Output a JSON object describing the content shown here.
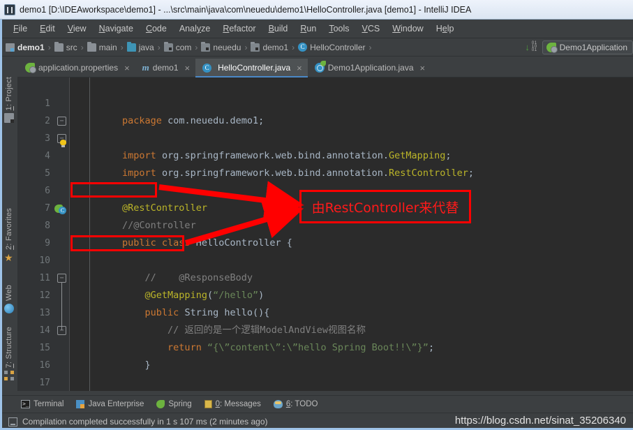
{
  "window": {
    "title": "demo1 [D:\\IDEAworkspace\\demo1] - ...\\src\\main\\java\\com\\neuedu\\demo1\\HelloController.java [demo1] - IntelliJ IDEA",
    "app_icon": "intellij-idea-icon"
  },
  "menubar": {
    "items": [
      {
        "label": "File",
        "mnemonic": "F"
      },
      {
        "label": "Edit",
        "mnemonic": "E"
      },
      {
        "label": "View",
        "mnemonic": "V"
      },
      {
        "label": "Navigate",
        "mnemonic": "N"
      },
      {
        "label": "Code",
        "mnemonic": "C"
      },
      {
        "label": "Analyze",
        "mnemonic": "y"
      },
      {
        "label": "Refactor",
        "mnemonic": "R"
      },
      {
        "label": "Build",
        "mnemonic": "B"
      },
      {
        "label": "Run",
        "mnemonic": "R"
      },
      {
        "label": "Tools",
        "mnemonic": "T"
      },
      {
        "label": "VCS",
        "mnemonic": "V"
      },
      {
        "label": "Window",
        "mnemonic": "W"
      },
      {
        "label": "Help",
        "mnemonic": "H"
      }
    ]
  },
  "breadcrumb": {
    "items": [
      {
        "label": "demo1",
        "icon": "module-icon"
      },
      {
        "label": "src",
        "icon": "folder-icon"
      },
      {
        "label": "main",
        "icon": "folder-icon"
      },
      {
        "label": "java",
        "icon": "source-folder-icon"
      },
      {
        "label": "com",
        "icon": "package-icon"
      },
      {
        "label": "neuedu",
        "icon": "package-icon"
      },
      {
        "label": "demo1",
        "icon": "package-icon"
      },
      {
        "label": "HelloController",
        "icon": "class-icon"
      }
    ],
    "separator": "›"
  },
  "toolbar_right": {
    "download_icon": "download-icon",
    "binary_icon": "binary-icon",
    "run_configuration": "Demo1Application",
    "run_config_icon": "spring-boot-icon"
  },
  "left_toolbar": {
    "items": [
      {
        "label": "1: Project",
        "mnemonic": "1",
        "icon": "project-icon"
      },
      {
        "label": "2: Favorites",
        "mnemonic": "2",
        "icon": "star-icon"
      },
      {
        "label": "Web",
        "mnemonic": "",
        "icon": "web-globe-icon"
      },
      {
        "label": "7: Structure",
        "mnemonic": "7",
        "icon": "structure-icon"
      }
    ]
  },
  "editor_tabs": [
    {
      "label": "application.properties",
      "icon": "spring-properties-icon",
      "active": false,
      "close": "×"
    },
    {
      "label": "demo1",
      "icon": "maven-icon",
      "active": false,
      "close": "×"
    },
    {
      "label": "HelloController.java",
      "icon": "java-class-icon",
      "active": true,
      "close": "×"
    },
    {
      "label": "Demo1Application.java",
      "icon": "spring-boot-class-icon",
      "active": false,
      "close": "×"
    }
  ],
  "code": {
    "lines": [
      {
        "no": "1",
        "tokens": [
          {
            "t": "package ",
            "c": "kw"
          },
          {
            "t": "com.neuedu.demo1",
            "c": "txt"
          },
          {
            "t": ";",
            "c": "sem"
          }
        ]
      },
      {
        "no": "2",
        "tokens": []
      },
      {
        "no": "3",
        "tokens": [
          {
            "t": "import ",
            "c": "kw"
          },
          {
            "t": "org.springframework.web.bind.annotation.",
            "c": "txt"
          },
          {
            "t": "GetMapping",
            "c": "ann"
          },
          {
            "t": ";",
            "c": "sem"
          }
        ]
      },
      {
        "no": "4",
        "tokens": [
          {
            "t": "import ",
            "c": "kw"
          },
          {
            "t": "org.springframework.web.bind.annotation.",
            "c": "txt"
          },
          {
            "t": "RestController",
            "c": "ann"
          },
          {
            "t": ";",
            "c": "sem"
          }
        ]
      },
      {
        "no": "5",
        "tokens": []
      },
      {
        "no": "6",
        "tokens": [
          {
            "t": "@RestController",
            "c": "ann"
          }
        ]
      },
      {
        "no": "7",
        "tokens": [
          {
            "t": "//@Controller",
            "c": "cmt"
          }
        ]
      },
      {
        "no": "8",
        "tokens": [
          {
            "t": "public class ",
            "c": "kw"
          },
          {
            "t": "HelloController ",
            "c": "txt"
          },
          {
            "t": "{",
            "c": "sem"
          }
        ]
      },
      {
        "no": "9",
        "tokens": []
      },
      {
        "no": "10",
        "tokens": [
          {
            "t": "    //    @ResponseBody",
            "c": "cmt"
          }
        ]
      },
      {
        "no": "11",
        "tokens": [
          {
            "t": "    @GetMapping",
            "c": "ann"
          },
          {
            "t": "(",
            "c": "sem"
          },
          {
            "t": "“/hello”",
            "c": "str"
          },
          {
            "t": ")",
            "c": "sem"
          }
        ]
      },
      {
        "no": "12",
        "tokens": [
          {
            "t": "    public ",
            "c": "kw"
          },
          {
            "t": "String hello",
            "c": "txt"
          },
          {
            "t": "(){",
            "c": "sem"
          }
        ]
      },
      {
        "no": "13",
        "tokens": [
          {
            "t": "        // 返回的是一个逻辑ModelAndView视图名称",
            "c": "cmt"
          }
        ]
      },
      {
        "no": "14",
        "tokens": [
          {
            "t": "        return ",
            "c": "kw"
          },
          {
            "t": "“{\\”content\\”:\\”hello Spring Boot!!\\”}”",
            "c": "str"
          },
          {
            "t": ";",
            "c": "sem"
          }
        ]
      },
      {
        "no": "15",
        "tokens": [
          {
            "t": "    }",
            "c": "sem"
          }
        ]
      },
      {
        "no": "16",
        "tokens": []
      },
      {
        "no": "17",
        "tokens": [
          {
            "t": "}",
            "c": "sem"
          }
        ]
      }
    ]
  },
  "annotations": {
    "boxes": [
      {
        "name": "highlight-controller-comment",
        "target_line": "7"
      },
      {
        "name": "highlight-responsebody-comment",
        "target_line": "10"
      }
    ],
    "callout_text": "由RestController来代替",
    "color": "#ff0000"
  },
  "bottom_toolbar": {
    "items": [
      {
        "label": "Terminal",
        "mnemonic": "",
        "icon": "terminal-icon"
      },
      {
        "label": "Java Enterprise",
        "mnemonic": "",
        "icon": "java-enterprise-icon"
      },
      {
        "label": "Spring",
        "mnemonic": "",
        "icon": "spring-leaf-icon"
      },
      {
        "label": "0: Messages",
        "mnemonic": "0",
        "icon": "messages-icon"
      },
      {
        "label": "6: TODO",
        "mnemonic": "6",
        "icon": "todo-icon"
      }
    ]
  },
  "statusbar": {
    "icon": "event-log-icon",
    "message": "Compilation completed successfully in 1 s 107 ms (2 minutes ago)",
    "watermark": "https://blog.csdn.net/sinat_35206340"
  }
}
